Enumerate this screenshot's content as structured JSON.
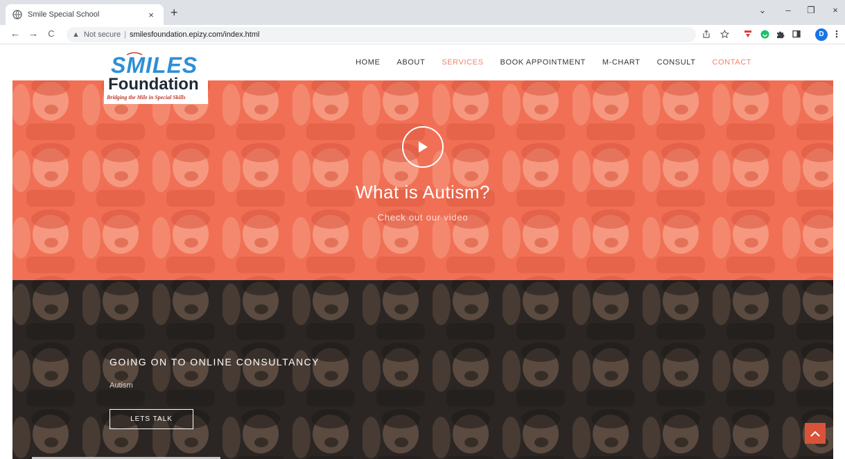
{
  "browser": {
    "tab_title": "Smile Special School",
    "tab_close": "×",
    "new_tab": "+",
    "nav": {
      "back": "←",
      "forward": "→",
      "reload": "C"
    },
    "address": {
      "warning_icon": "▲",
      "security_label": "Not secure",
      "separator": "|",
      "url": "smilesfoundation.epizy.com/index.html"
    },
    "window_controls": {
      "menu": "⌄",
      "minimize": "–",
      "maximize": "❐",
      "close": "×"
    },
    "profile_initial": "D",
    "icons": [
      "share-icon",
      "star-icon",
      "extension-red-icon",
      "extension-green-icon",
      "puzzle-icon",
      "sidepanel-icon",
      "profile-avatar",
      "kebab-menu-icon"
    ]
  },
  "site": {
    "logo": {
      "name": "SMILES",
      "subname": "Foundation",
      "tagline": "Bridging the Mile in Special Skills"
    },
    "nav": [
      {
        "label": "HOME",
        "active": false
      },
      {
        "label": "ABOUT",
        "active": false
      },
      {
        "label": "SERVICES",
        "active": true
      },
      {
        "label": "BOOK APPOINTMENT",
        "active": false
      },
      {
        "label": "M-CHART",
        "active": false
      },
      {
        "label": "CONSULT",
        "active": false
      },
      {
        "label": "CONTACT",
        "active": true
      }
    ],
    "hero": {
      "title": "What is Autism?",
      "subtitle": "Check out our video",
      "overlay_color": "#f17055"
    },
    "consult": {
      "heading": "GOING ON TO ONLINE CONSULTANCY",
      "subheading": "Autism",
      "button": "LETS TALK"
    },
    "accent_color": "#f0826b",
    "back_to_top_color": "#d9533a"
  }
}
